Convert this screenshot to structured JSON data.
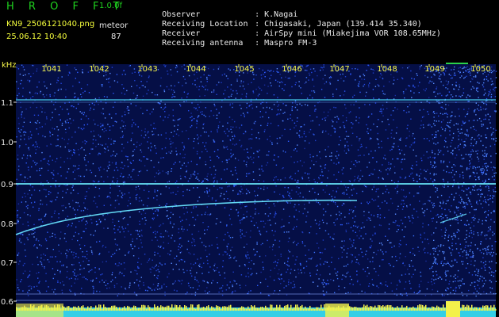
{
  "app": {
    "title": "H R O F F T",
    "version": "1.0.0f",
    "mode": "meteor"
  },
  "file": {
    "name": "KN9_2506121040.png",
    "datetime": "25.06.12 10:40",
    "count": "87"
  },
  "info": [
    {
      "label": "Observer",
      "value": ": K.Nagai"
    },
    {
      "label": "Receiving Location",
      "value": ": Chigasaki, Japan (139.414 35.340)"
    },
    {
      "label": "Receiver",
      "value": ": AirSpy mini (Miakejima VOR 108.65MHz)"
    },
    {
      "label": "Receiving antenna",
      "value": ": Maspro FM-3"
    }
  ],
  "axis": {
    "x_unit": "kHz",
    "x_ticks": [
      "1041",
      "1042",
      "1043",
      "1044",
      "1045",
      "1046",
      "1047",
      "1048",
      "1049",
      "1050"
    ],
    "y_ticks": [
      "1.1",
      "1.0",
      "0.9",
      "0.8",
      "0.7",
      "0.6"
    ]
  },
  "colors": {
    "background": "#050f46",
    "noise": "#2f6bff",
    "trace": "#5fe0ff",
    "header_accent": "#1fd21f",
    "highlight": "#f6ff3c"
  }
}
